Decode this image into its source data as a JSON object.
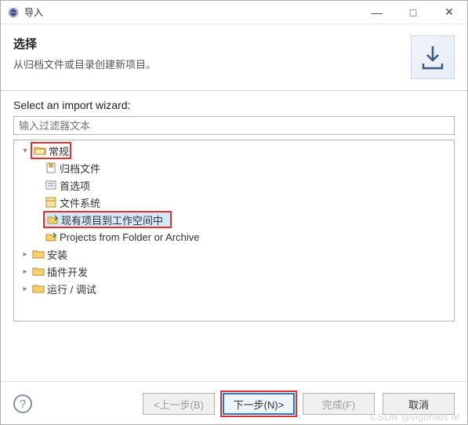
{
  "window": {
    "title": "导入",
    "minimize": "—",
    "maximize": "□",
    "close": "✕"
  },
  "header": {
    "title": "选择",
    "description": "从归档文件或目录创建新项目。"
  },
  "wizard": {
    "label": "Select an import wizard:",
    "filter_placeholder": "输入过滤器文本"
  },
  "tree": {
    "nodes": [
      {
        "id": "general",
        "label": "常规",
        "expanded": true,
        "highlight": true
      },
      {
        "id": "archive",
        "label": "归档文件",
        "parent": "general"
      },
      {
        "id": "prefs",
        "label": "首选项",
        "parent": "general"
      },
      {
        "id": "filesystem",
        "label": "文件系统",
        "parent": "general"
      },
      {
        "id": "existing",
        "label": "现有项目到工作空间中",
        "parent": "general",
        "selected": true,
        "highlight": true
      },
      {
        "id": "folder-archive",
        "label": "Projects from Folder or Archive",
        "parent": "general"
      },
      {
        "id": "install",
        "label": "安装",
        "expanded": false
      },
      {
        "id": "plugin-dev",
        "label": "插件开发",
        "expanded": false
      },
      {
        "id": "run-debug",
        "label": "运行 / 调试",
        "expanded": false
      }
    ]
  },
  "buttons": {
    "back": "<上一步(B)",
    "next": "下一步(N)>",
    "finish": "完成(F)",
    "cancel": "取消"
  },
  "watermark": "CSDN @vigorous of"
}
